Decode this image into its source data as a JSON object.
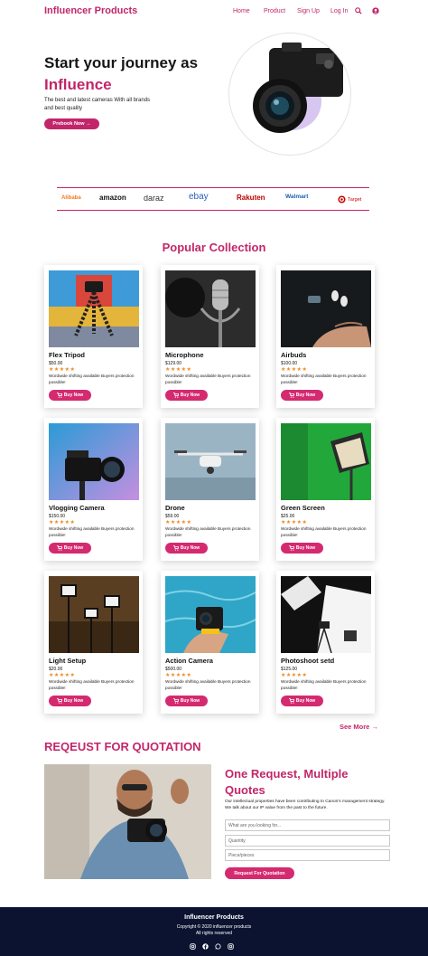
{
  "nav": {
    "brand": "Influencer Products",
    "items": [
      "Home",
      "Product",
      "Sign Up",
      "Log In"
    ],
    "icons": [
      "search-icon",
      "user-icon"
    ]
  },
  "hero": {
    "title": "Start your journey as",
    "accent": "Influence",
    "subtitle": "The best and latest cameras With all brands and best quality",
    "button": "Prebook Now →"
  },
  "brands": [
    "Alibaba",
    "amazon",
    "daraz",
    "ebay",
    "Rakuten",
    "Walmart",
    "Target"
  ],
  "collection": {
    "title": "Popular Collection",
    "buy_label": "Buy Now",
    "stars": "★★★★★",
    "description": "Wordwide shifting available Buyers protection possible!",
    "products": [
      {
        "name": "Flex Tripod",
        "price": "$50.00"
      },
      {
        "name": "Microphone",
        "price": "$129.00"
      },
      {
        "name": "Airbuds",
        "price": "$100.00"
      },
      {
        "name": "Vlogging Camera",
        "price": "$150.00"
      },
      {
        "name": "Drone",
        "price": "$59.00"
      },
      {
        "name": "Green Screen",
        "price": "$25.00"
      },
      {
        "name": "Light Setup",
        "price": "$20.00"
      },
      {
        "name": "Action Camera",
        "price": "$500.00"
      },
      {
        "name": "Photoshoot setd",
        "price": "$125.00"
      }
    ],
    "see_more": "See More →"
  },
  "quotation": {
    "title": "REQEUST FOR QUOTATION",
    "heading": "One Request, Multiple Quotes",
    "text": "Our intellectual properties have been contributing to Canon's management strategy. We talk about our IP value from the past to the future.",
    "placeholders": [
      "What are you looking for...",
      "Quantity",
      "Piece/pieces"
    ],
    "button": "Request For Quotation"
  },
  "footer": {
    "title": "Influencer Products",
    "copyright": "Copyright © 2020 influencer products",
    "rights": "All rights reserved",
    "social": [
      "instagram-icon",
      "facebook-icon",
      "whatsapp-icon",
      "instagram-icon"
    ]
  },
  "colors": {
    "accent": "#c2266a",
    "button": "#d42a6f",
    "footer_bg": "#0b1330",
    "stars": "#f08a24"
  }
}
